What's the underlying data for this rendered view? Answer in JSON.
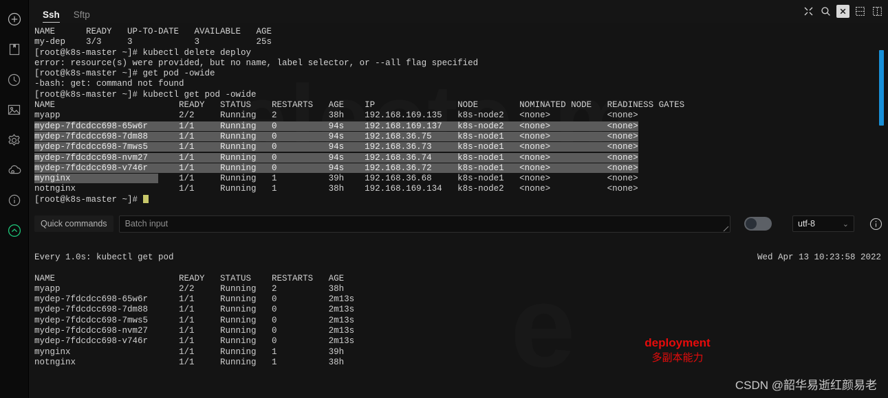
{
  "app": {
    "name": "electerm",
    "watermark_terminal": "electerm",
    "watermark_watch": "e",
    "csdn_watermark": "CSDN @韶华易逝红颜易老"
  },
  "header": {
    "tabs": [
      {
        "label": "Ssh",
        "active": true
      },
      {
        "label": "Sftp",
        "active": false
      }
    ],
    "icons": [
      {
        "name": "fullscreen-icon",
        "title": "Fullscreen"
      },
      {
        "name": "search-icon",
        "title": "Search"
      },
      {
        "name": "close-icon",
        "title": "Close"
      },
      {
        "name": "split-horizontal-icon",
        "title": "Split horizontally"
      },
      {
        "name": "split-vertical-icon",
        "title": "Split vertically"
      }
    ]
  },
  "sidebar": {
    "items": [
      {
        "name": "add-icon",
        "label": "Add"
      },
      {
        "name": "bookmark-icon",
        "label": "Bookmarks"
      },
      {
        "name": "history-icon",
        "label": "History"
      },
      {
        "name": "gallery-icon",
        "label": "Theme / Background"
      },
      {
        "name": "gear-icon",
        "label": "Settings"
      },
      {
        "name": "cloud-icon",
        "label": "Sync"
      },
      {
        "name": "info-icon",
        "label": "Info"
      },
      {
        "name": "chevron-up-icon",
        "label": "Collapse"
      }
    ]
  },
  "terminal": {
    "lines": [
      {
        "text": "NAME      READY   UP-TO-DATE   AVAILABLE   AGE",
        "selected": false
      },
      {
        "text": "my-dep    3/3     3            3           25s",
        "selected": false
      },
      {
        "text": "[root@k8s-master ~]# kubectl delete deploy",
        "selected": false
      },
      {
        "text": "error: resource(s) were provided, but no name, label selector, or --all flag specified",
        "selected": false
      },
      {
        "text": "[root@k8s-master ~]# get pod -owide",
        "selected": false
      },
      {
        "text": "-bash: get: command not found",
        "selected": false
      },
      {
        "text": "[root@k8s-master ~]# kubectl get pod -owide",
        "selected": false
      },
      {
        "text": "NAME                        READY   STATUS    RESTARTS   AGE    IP                NODE        NOMINATED NODE   READINESS GATES",
        "selected": false
      },
      {
        "text": "myapp                       2/2     Running   2          38h    192.168.169.135   k8s-node2   <none>           <none>",
        "selected": false
      },
      {
        "text": "mydep-7fdcdcc698-65w6r      1/1     Running   0          94s    192.168.169.137   k8s-node2   <none>           <none>",
        "selected": true
      },
      {
        "text": "mydep-7fdcdcc698-7dm88      1/1     Running   0          94s    192.168.36.75     k8s-node1   <none>           <none>",
        "selected": true
      },
      {
        "text": "mydep-7fdcdcc698-7mws5      1/1     Running   0          94s    192.168.36.73     k8s-node1   <none>           <none>",
        "selected": true
      },
      {
        "text": "mydep-7fdcdcc698-nvm27      1/1     Running   0          94s    192.168.36.74     k8s-node1   <none>           <none>",
        "selected": true
      },
      {
        "text": "mydep-7fdcdcc698-v746r      1/1     Running   0          94s    192.168.36.72     k8s-node1   <none>           <none>",
        "selected": true
      },
      {
        "text": "mynginx                     1/1     Running   1          39h    192.168.36.68     k8s-node1   <none>           <none>",
        "selected": "partial"
      },
      {
        "text": "notnginx                    1/1     Running   1          38h    192.168.169.134   k8s-node2   <none>           <none>",
        "selected": false
      }
    ],
    "prompt": "[root@k8s-master ~]# "
  },
  "toolbar": {
    "quick_commands_label": "Quick commands",
    "batch_input_placeholder": "Batch input",
    "batch_input_value": "",
    "toggle_on": false,
    "encoding_value": "utf-8",
    "encoding_caret": "⌄",
    "info_icon": "info-icon"
  },
  "watch": {
    "header": "Every 1.0s: kubectl get pod",
    "clock": "Wed Apr 13 10:23:58 2022",
    "lines": [
      "NAME                        READY   STATUS    RESTARTS   AGE",
      "myapp                       2/2     Running   2          38h",
      "mydep-7fdcdcc698-65w6r      1/1     Running   0          2m13s",
      "mydep-7fdcdcc698-7dm88      1/1     Running   0          2m13s",
      "mydep-7fdcdcc698-7mws5      1/1     Running   0          2m13s",
      "mydep-7fdcdcc698-nvm27      1/1     Running   0          2m13s",
      "mydep-7fdcdcc698-v746r      1/1     Running   0          2m13s",
      "mynginx                     1/1     Running   1          39h",
      "notnginx                    1/1     Running   1          38h"
    ]
  },
  "annotation": {
    "line1": "deployment",
    "line2": "多副本能力",
    "color": "#e60b0b"
  },
  "colors": {
    "background": "#141414",
    "rail": "#0b0b0b",
    "selection": "#5b5b5b",
    "scrollbar": "#1890d8",
    "cursor": "#c8c86a",
    "accent_green": "#1ec77a"
  }
}
